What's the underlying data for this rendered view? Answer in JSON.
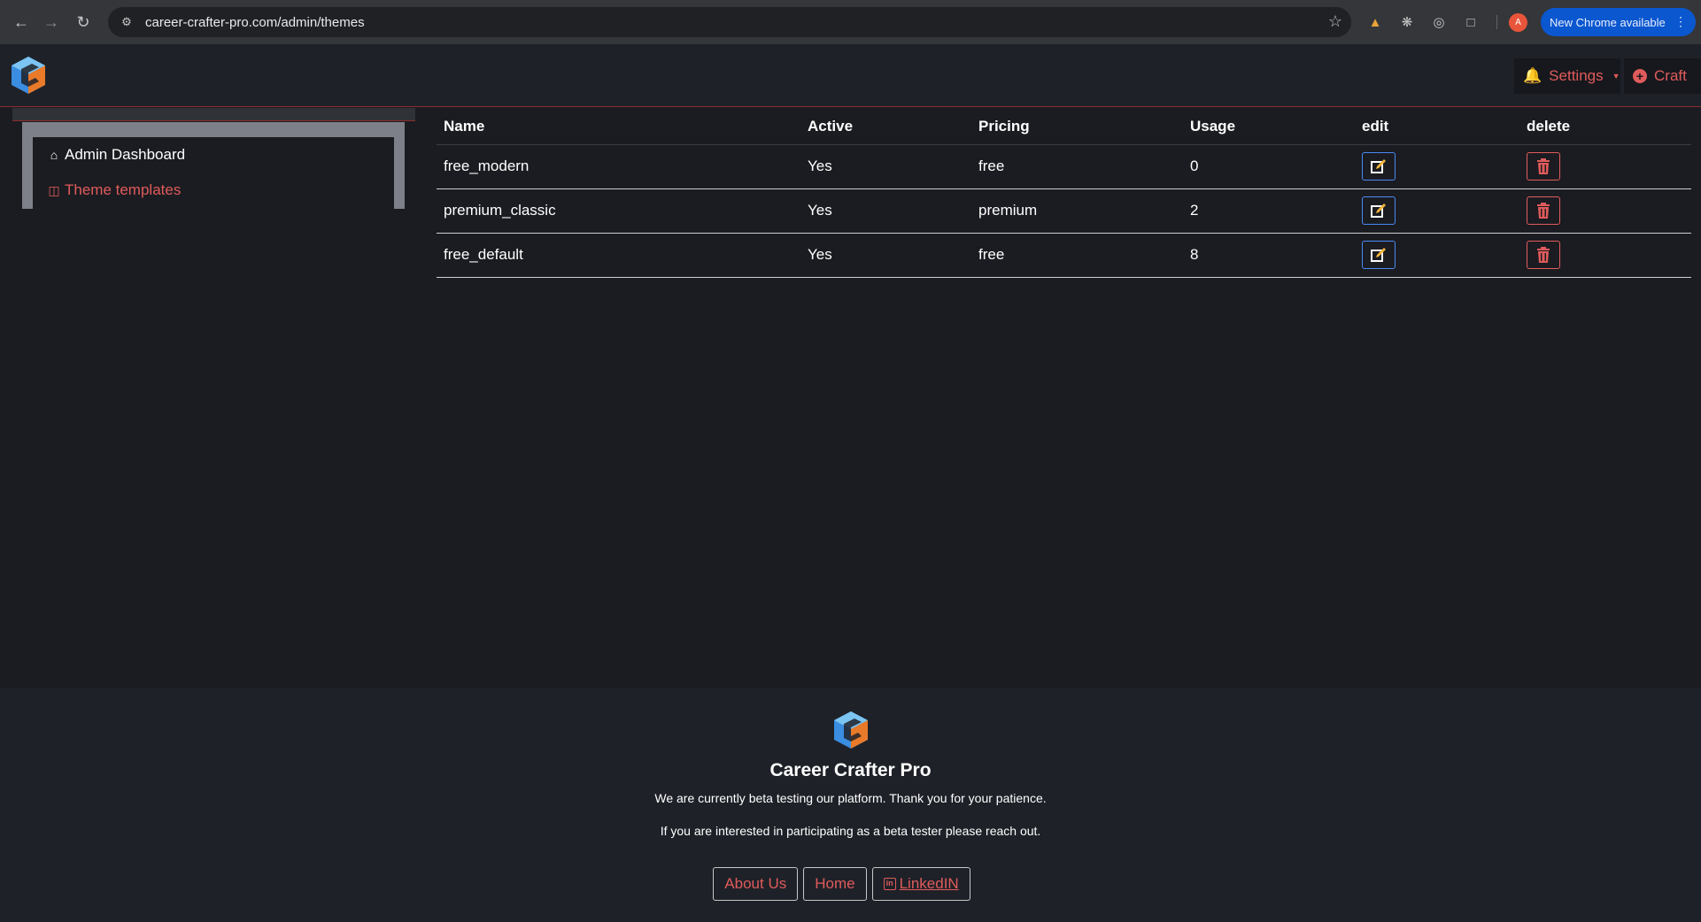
{
  "browser": {
    "url": "career-crafter-pro.com/admin/themes",
    "profile_initial": "A",
    "update_label": "New Chrome available"
  },
  "header": {
    "logo_icon": "career-crafter-logo",
    "settings_label": "Settings",
    "craft_label": "Craft"
  },
  "sidebar": {
    "items": [
      {
        "label": "Admin Dashboard",
        "icon": "home-icon",
        "active": false
      },
      {
        "label": "Theme templates",
        "icon": "briefcase-icon",
        "active": true
      }
    ]
  },
  "table": {
    "columns": [
      "Name",
      "Active",
      "Pricing",
      "Usage",
      "edit",
      "delete"
    ],
    "rows": [
      {
        "name": "free_modern",
        "active": "Yes",
        "pricing": "free",
        "usage": "0"
      },
      {
        "name": "premium_classic",
        "active": "Yes",
        "pricing": "premium",
        "usage": "2"
      },
      {
        "name": "free_default",
        "active": "Yes",
        "pricing": "free",
        "usage": "8"
      }
    ]
  },
  "footer": {
    "title": "Career Crafter Pro",
    "line1": "We are currently beta testing our platform. Thank you for your patience.",
    "line2": "If you are interested in participating as a beta tester please reach out.",
    "links": [
      "About Us",
      "Home",
      "LinkedIN"
    ]
  },
  "colors": {
    "accent_red": "#e05b5b",
    "edit_blue": "#4a8af4",
    "background": "#1b1c21",
    "header_bg": "#1e2128"
  }
}
